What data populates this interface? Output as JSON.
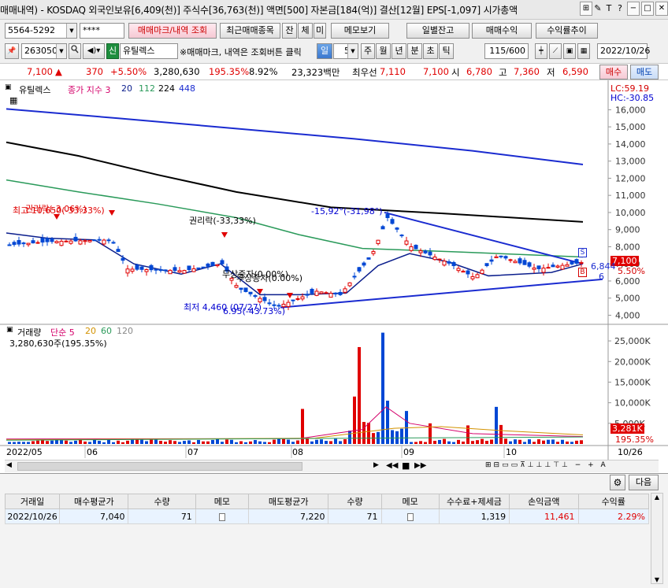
{
  "window": {
    "title": "매매내역) - KOSDAQ 외국인보유[6,409(천)] 주식수[36,763(천)] 액면[500] 자본금[184(억)] 결산[12월] EPS[-1,097] 시가총액",
    "ctrl_icons": [
      "⊞",
      "✎",
      "T",
      "?"
    ],
    "ctrl_btns": [
      "−",
      "□",
      "✕"
    ]
  },
  "toolbar1": {
    "account": "5564-5292",
    "password": "****",
    "buttons": [
      "매매마크/내역 조회",
      "최근매매종목",
      "잔",
      "체",
      "미",
      "메모보기",
      "일별잔고",
      "매매수익",
      "수익률추이"
    ]
  },
  "toolbar2": {
    "code": "263050",
    "badge": "신",
    "name": "유틸렉스",
    "hint": "※매매마크, 내역은 조회버튼 클릭",
    "periods": [
      "일",
      "5",
      "주",
      "월",
      "년",
      "분",
      "초",
      "틱"
    ],
    "count": "115/600",
    "date": "2022/10/26"
  },
  "quote": {
    "price": "7,100",
    "arrow": "▲",
    "change": "370",
    "pct": "+5.50%",
    "volume": "3,280,630",
    "vol_ratio": "195.35%",
    "turnover": "8.92%",
    "amount": "23,323백만",
    "prio_label": "최우선",
    "ask": "7,110",
    "bid": "7,100",
    "open_label": "시",
    "open": "6,780",
    "high_label": "고",
    "high": "7,360",
    "low_label": "저",
    "low": "6,590",
    "buy": "매수",
    "sell": "매도"
  },
  "chart_texts": {
    "price_title": "유틸렉스",
    "ma_label": "종가 지수 3",
    "ma_periods": [
      "20",
      "112",
      "224",
      "448"
    ],
    "lc": "LC:59.19",
    "hc": "HC:-30.85",
    "vol_title": "거래량",
    "vol_ma_label": "단순 5",
    "vol_periods": [
      "20",
      "60",
      "120"
    ],
    "vol_value": "3,280,630주(195.35%)",
    "ann_left": "최고 10,650(-33.33%)",
    "ann_rights1": "권리락(-33,33%)",
    "ann_rights2": "권리락(-3.06%)",
    "ann_increase": "무상증자(0.00%)",
    "ann_increase2": "무상증자(0.00%)",
    "ann_low": "최저 4,460 (07/27)",
    "ann_low_pct": "6.95(-43.73%)",
    "ann_peak": "-15,92°(-31,98°)",
    "price_tag": "7,100",
    "pct_tag": "5.50%",
    "line_tag": "6,844",
    "low_tag": "6",
    "vol_tag": "3,281K",
    "vol_pct_tag": "195.35%",
    "dates": [
      "2022/05",
      "06",
      "07",
      "08",
      "09",
      "10",
      "10/26"
    ]
  },
  "chart_data": [
    {
      "type": "line",
      "title": "유틸렉스",
      "y_axis_ticks": [
        4000,
        5000,
        6000,
        7000,
        8000,
        9000,
        10000,
        11000,
        12000,
        13000,
        14000,
        15000,
        16000
      ],
      "ylim": [
        3700,
        16800
      ],
      "x_ticks": [
        "2022/05",
        "06",
        "07",
        "08",
        "09",
        "10",
        "10/26"
      ],
      "series": [
        {
          "name": "20",
          "color": "#0b1e8c"
        },
        {
          "name": "112",
          "color": "#2a9a5a"
        },
        {
          "name": "224",
          "color": "#000000"
        },
        {
          "name": "448",
          "color": "#1a2bd0"
        }
      ],
      "last_close": 7100
    },
    {
      "type": "bar",
      "title": "거래량",
      "y_axis_ticks": [
        "5,000K",
        "10,000K",
        "15,000K",
        "20,000K",
        "25,000K"
      ],
      "ylim": [
        0,
        27500
      ],
      "last_volume_k": 3281
    }
  ],
  "pager": {
    "next": "다음"
  },
  "trade_table": {
    "headers": [
      "거래일",
      "매수평균가",
      "수량",
      "메모",
      "매도평균가",
      "수량",
      "메모",
      "수수료+제세금",
      "손익금액",
      "수익률"
    ],
    "rows": [
      [
        "2022/10/26",
        "7,040",
        "71",
        "",
        "7,220",
        "71",
        "",
        "1,319",
        "11,461",
        "2.29%"
      ]
    ]
  }
}
